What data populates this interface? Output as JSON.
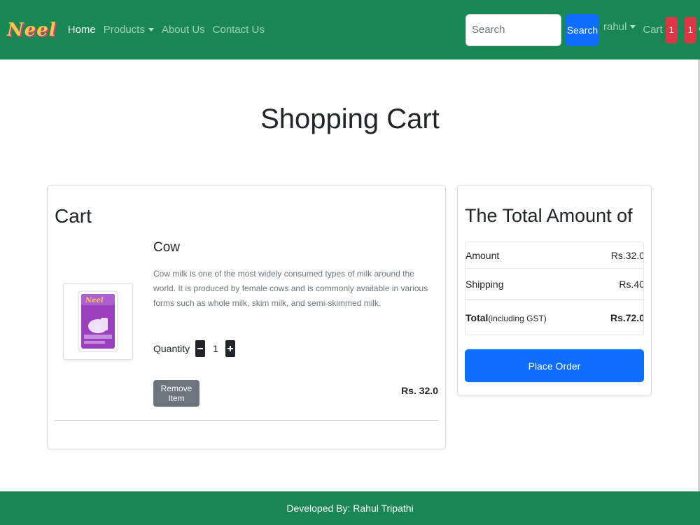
{
  "navbar": {
    "brand": "Neel",
    "links": [
      {
        "label": "Home",
        "active": true
      },
      {
        "label": "Products",
        "dropdown": true
      },
      {
        "label": "About Us"
      },
      {
        "label": "Contact Us"
      }
    ],
    "search": {
      "placeholder": "Search",
      "button_label": "Search"
    },
    "user": "rahul",
    "cart_label": "Cart",
    "cart_count": "1",
    "wishlist_count": "1",
    "colors": {
      "navbar": "#198754",
      "badge": "#dc3545",
      "primary": "#0d6efd"
    }
  },
  "page": {
    "title": "Shopping Cart"
  },
  "cart": {
    "heading": "Cart",
    "item": {
      "name": "Cow",
      "description": "Cow milk is one of the most widely consumed types of milk around the world. It is produced by female cows and is commonly available in various forms such as whole milk, skim milk, and semi-skimmed milk.",
      "quantity_label": "Quantity",
      "quantity": "1",
      "remove_label": "Remove Item",
      "price": "Rs. 32.0",
      "image_label": "Neel"
    }
  },
  "summary": {
    "heading": "The Total Amount of",
    "amount_label": "Amount",
    "amount_value": "Rs.32.0",
    "shipping_label": "Shipping",
    "shipping_value": "Rs.40",
    "total_label": "Total",
    "total_note": "(including GST)",
    "total_value": "Rs.72.0",
    "place_order_label": "Place Order"
  },
  "footer": {
    "text": "Developed By: Rahul Tripathi"
  }
}
